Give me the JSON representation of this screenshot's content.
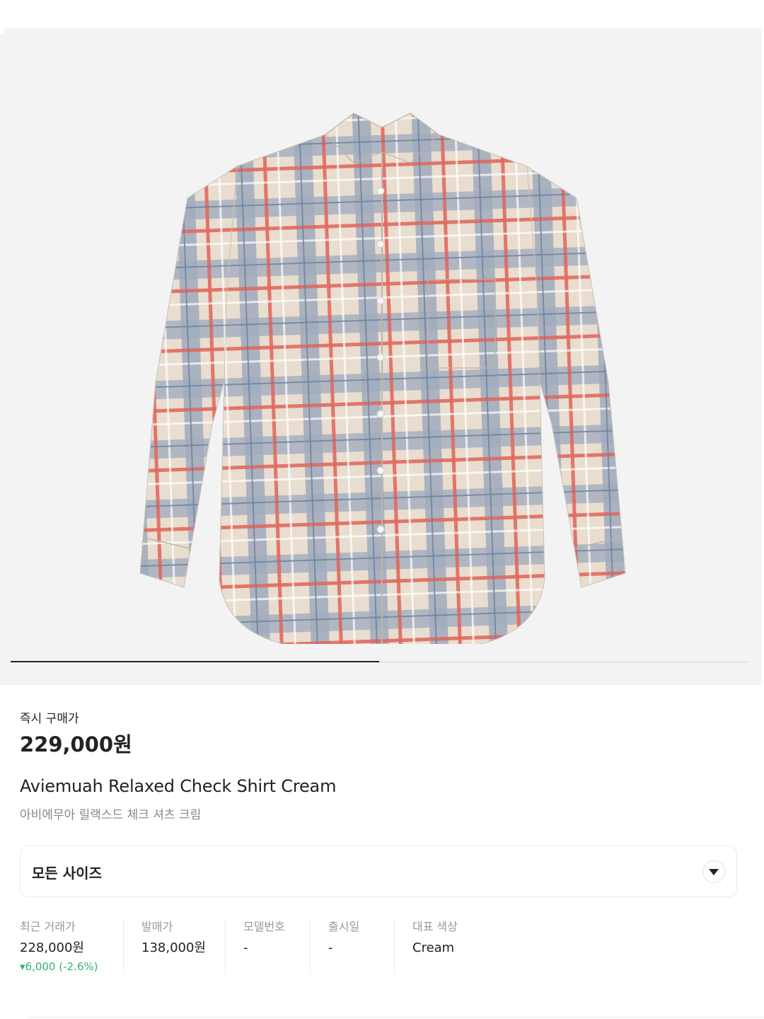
{
  "product_image": {
    "name": "plaid-check-shirt"
  },
  "gallery": {
    "progress": 0.5
  },
  "buy_now": {
    "label": "즉시 구매가",
    "price": "229,000원"
  },
  "product": {
    "title_en": "Aviemuah Relaxed Check Shirt Cream",
    "title_ko": "아비에무아 릴랙스드 체크 셔츠 크림"
  },
  "size_select": {
    "label": "모든 사이즈",
    "icon": "chevron-down-icon"
  },
  "info": {
    "recent_trade": {
      "label": "최근 거래가",
      "value": "228,000원",
      "change": "▾6,000 (-2.6%)"
    },
    "release_price": {
      "label": "발매가",
      "value": "138,000원"
    },
    "model_no": {
      "label": "모델번호",
      "value": "-"
    },
    "release_date": {
      "label": "출시일",
      "value": "-"
    },
    "color": {
      "label": "대표 색상",
      "value": "Cream"
    }
  },
  "colors": {
    "accent_down": "#31b46e",
    "text": "#222222",
    "muted": "#999999",
    "image_bg": "#f3f3f3"
  }
}
